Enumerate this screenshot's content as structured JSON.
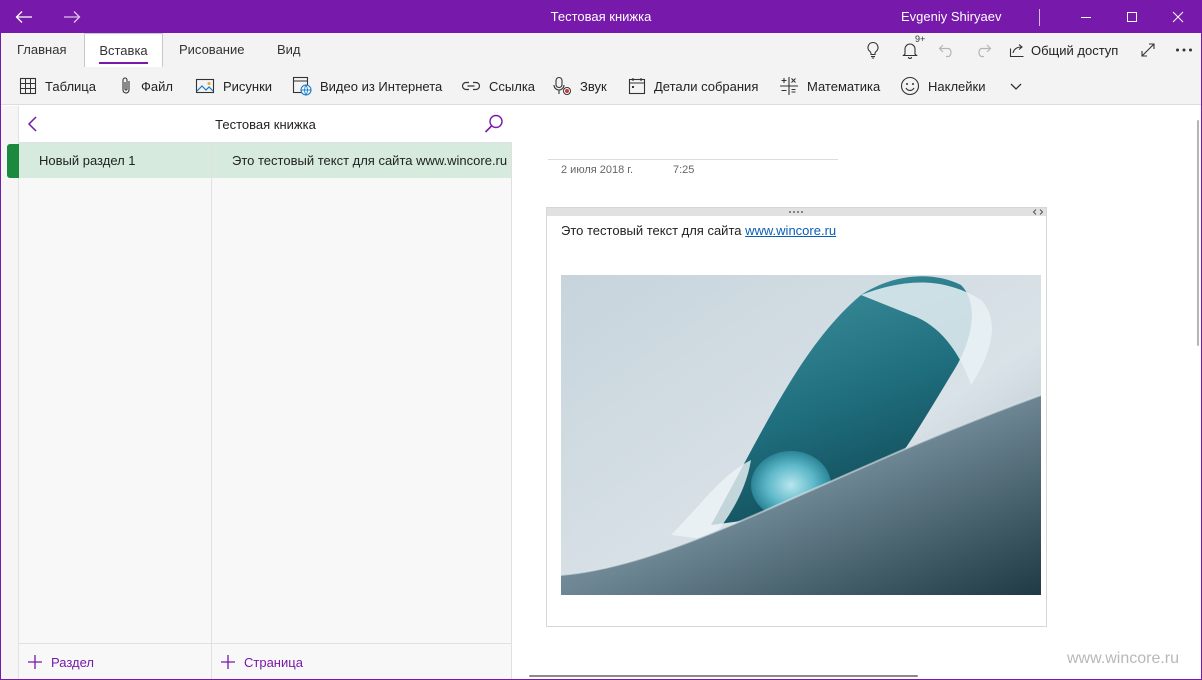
{
  "titlebar": {
    "title": "Тестовая книжка",
    "user": "Evgeniy Shiryaev",
    "accent": "#7719aa"
  },
  "tabs": [
    {
      "label": "Главная"
    },
    {
      "label": "Вставка",
      "active": true
    },
    {
      "label": "Рисование"
    },
    {
      "label": "Вид"
    }
  ],
  "toolbar": {
    "notifications_badge": "9+",
    "share_label": "Общий доступ"
  },
  "ribbon": {
    "items": [
      {
        "label": "Таблица",
        "icon": "table-icon"
      },
      {
        "label": "Файл",
        "icon": "paperclip-icon"
      },
      {
        "label": "Рисунки",
        "icon": "picture-icon"
      },
      {
        "label": "Видео из Интернета",
        "icon": "online-video-icon"
      },
      {
        "label": "Ссылка",
        "icon": "link-icon"
      },
      {
        "label": "Звук",
        "icon": "microphone-icon"
      },
      {
        "label": "Детали собрания",
        "icon": "calendar-icon"
      },
      {
        "label": "Математика",
        "icon": "math-icon"
      },
      {
        "label": "Наклейки",
        "icon": "sticker-icon"
      }
    ]
  },
  "nav": {
    "notebook_title": "Тестовая книжка",
    "section": "Новый раздел 1",
    "section_color": "#1b8a3f",
    "page": "Это тестовый текст для сайта www.wincore.ru",
    "add_section": "Раздел",
    "add_page": "Страница"
  },
  "page": {
    "date": "2 июля 2018 г.",
    "time": "7:25",
    "text_before_link": "Это тестовый текст для сайта ",
    "link": "www.wincore.ru"
  },
  "watermark": "www.wincore.ru"
}
